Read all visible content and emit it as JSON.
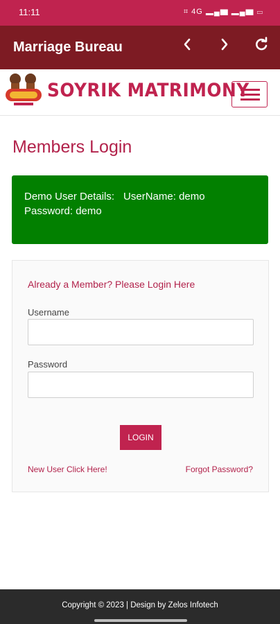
{
  "status_bar": {
    "time": "11:11",
    "icons_text": "⌗ 4G ▂▄▆ ▂▄▆ ▭"
  },
  "app_bar": {
    "title": "Marriage Bureau",
    "back_icon": "chevron-left",
    "forward_icon": "chevron-right",
    "refresh_icon": "refresh"
  },
  "header": {
    "logo_text": "SOYRIK MATRIMONY",
    "brand_color": "#c0234f"
  },
  "page": {
    "title": "Members Login"
  },
  "demo": {
    "label": "Demo User Details:",
    "username_text": "UserName: demo",
    "password_text": "Password: demo",
    "background": "#028000"
  },
  "login": {
    "heading": "Already a Member? Please Login Here",
    "username_label": "Username",
    "username_value": "",
    "password_label": "Password",
    "password_value": "",
    "button_label": "LOGIN",
    "new_user_link": "New User Click Here!",
    "forgot_link": "Forgot Password?"
  },
  "footer": {
    "text": "Copyright © 2023 | Design by Zelos Infotech"
  }
}
